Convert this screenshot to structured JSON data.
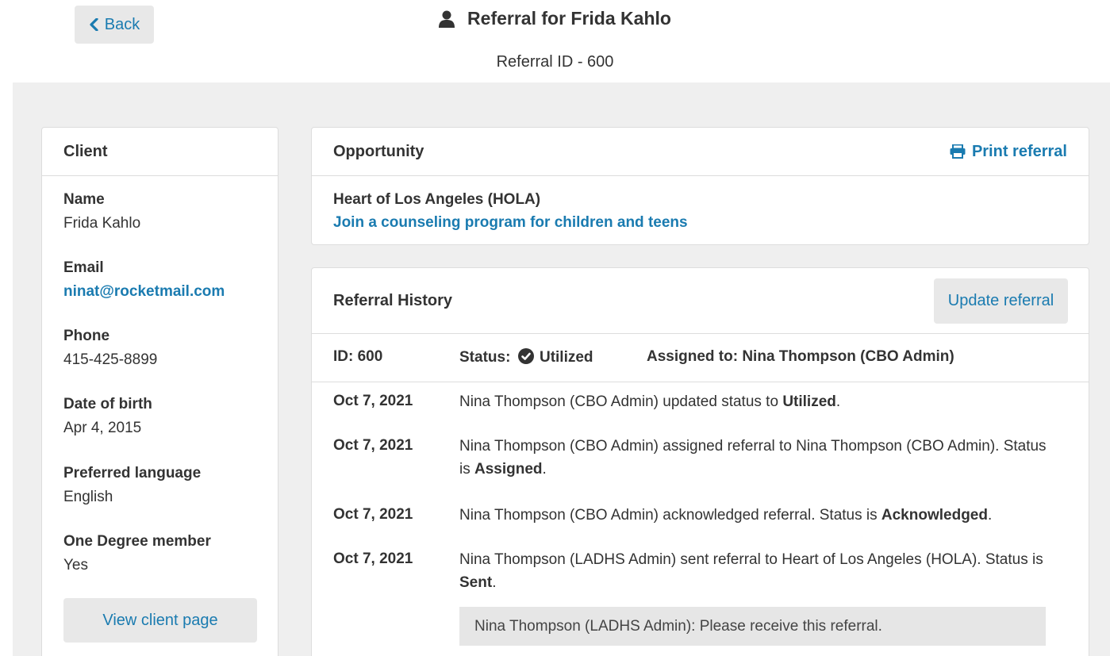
{
  "header": {
    "back_label": "Back",
    "title": "Referral for Frida Kahlo",
    "subtitle": "Referral ID - 600"
  },
  "client": {
    "heading": "Client",
    "fields": [
      {
        "label": "Name",
        "value": "Frida Kahlo"
      },
      {
        "label": "Email",
        "value": "ninat@rocketmail.com"
      },
      {
        "label": "Phone",
        "value": "415-425-8899"
      },
      {
        "label": "Date of birth",
        "value": "Apr 4, 2015"
      },
      {
        "label": "Preferred language",
        "value": "English"
      },
      {
        "label": "One Degree member",
        "value": "Yes"
      }
    ],
    "view_button": "View client page"
  },
  "opportunity": {
    "heading": "Opportunity",
    "print_label": "Print referral",
    "org": "Heart of Los Angeles (HOLA)",
    "link": "Join a counseling program for children and teens"
  },
  "history": {
    "heading": "Referral History",
    "update_button": "Update referral",
    "id_label": "ID: 600",
    "status_label": "Status:",
    "status_value": "Utilized",
    "assigned_label": "Assigned to: Nina Thompson (CBO Admin)",
    "events": [
      {
        "date": "Oct 7, 2021",
        "text_before": "Nina Thompson (CBO Admin) updated status to ",
        "bold": "Utilized",
        "text_after": "."
      },
      {
        "date": "Oct 7, 2021",
        "text_before": "Nina Thompson (CBO Admin) assigned referral to Nina Thompson (CBO Admin). Status is ",
        "bold": "Assigned",
        "text_after": "."
      },
      {
        "date": "Oct 7, 2021",
        "text_before": "Nina Thompson (CBO Admin) acknowledged referral. Status is ",
        "bold": "Acknowledged",
        "text_after": "."
      },
      {
        "date": "Oct 7, 2021",
        "text_before": "Nina Thompson (LADHS Admin) sent referral to Heart of Los Angeles (HOLA). Status is ",
        "bold": "Sent",
        "text_after": "."
      }
    ],
    "note": "Nina Thompson (LADHS Admin): Please receive this referral."
  },
  "colors": {
    "link": "#1a7bb0",
    "background": "#efefef",
    "button_bg": "#e8e8e8"
  },
  "icons": [
    "chevron-left-icon",
    "user-icon",
    "printer-icon",
    "check-circle-icon"
  ]
}
